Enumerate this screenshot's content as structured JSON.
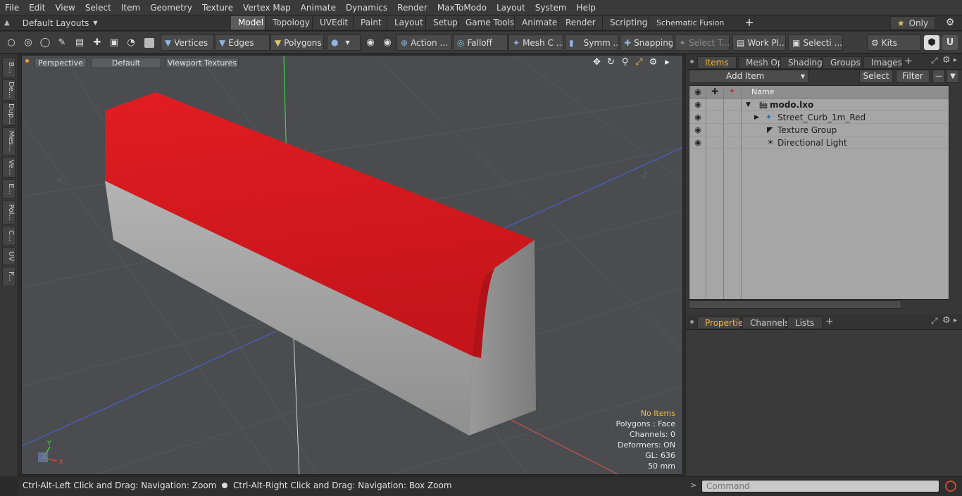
{
  "menu": [
    "File",
    "Edit",
    "View",
    "Select",
    "Item",
    "Geometry",
    "Texture",
    "Vertex Map",
    "Animate",
    "Dynamics",
    "Render",
    "MaxToModo",
    "Layout",
    "System",
    "Help"
  ],
  "layouts_dropdown": "Default Layouts",
  "layout_tabs": [
    {
      "label": "Model",
      "active": true
    },
    {
      "label": "Topology"
    },
    {
      "label": "UVEdit"
    },
    {
      "label": "Paint"
    },
    {
      "label": "Layout"
    },
    {
      "label": "Setup"
    },
    {
      "label": "Game Tools"
    },
    {
      "label": "Animate"
    },
    {
      "label": "Render"
    },
    {
      "label": "Scripting"
    },
    {
      "label": "Schematic Fusion"
    }
  ],
  "only_label": "Only",
  "toolbar": {
    "vertices": "Vertices",
    "edges": "Edges",
    "polygons": "Polygons",
    "action": "Action ...",
    "falloff": "Falloff",
    "mesh": "Mesh C ...",
    "symm": "Symm ...",
    "snapping": "Snapping",
    "select_t": "Select T...",
    "work_pl": "Work Pl...",
    "selecti": "Selecti ...",
    "kits": "Kits"
  },
  "left_strip": [
    "B...",
    "De...",
    "Dup...",
    "Mes...",
    "Ve...",
    "E...",
    "Pol...",
    "C...",
    "UV",
    "F..."
  ],
  "viewport": {
    "perspective": "Perspective",
    "default": "Default",
    "textures": "Viewport Textures",
    "axis_x": "-X",
    "axis_z": "-Z",
    "gizmo_y": "Y",
    "gizmo_x": "X",
    "info": {
      "no_items": "No Items",
      "polygons": "Polygons : Face",
      "channels": "Channels: 0",
      "deformers": "Deformers: ON",
      "gl": "GL: 636",
      "size": "50 mm"
    },
    "colors": {
      "red_top": "#d3151a",
      "concrete": "#a8a8a8",
      "bg": "#4a4c4f"
    }
  },
  "right_panel": {
    "top_tabs": [
      "Items",
      "Mesh Ops",
      "Shading",
      "Groups",
      "Images"
    ],
    "add_item": "Add Item",
    "select": "Select",
    "filter": "Filter",
    "name_header": "Name",
    "items": [
      {
        "label": "modo.lxo",
        "bold": true
      },
      {
        "label": "Street_Curb_1m_Red"
      },
      {
        "label": "Texture Group"
      },
      {
        "label": "Directional Light"
      }
    ],
    "bottom_tabs": [
      "Properties",
      "Channels",
      "Lists"
    ]
  },
  "status": {
    "hint_left": "Ctrl-Alt-Left Click and Drag: Navigation: Zoom",
    "hint_right": "Ctrl-Alt-Right Click and Drag: Navigation: Box Zoom"
  },
  "command": {
    "placeholder": "Command"
  }
}
